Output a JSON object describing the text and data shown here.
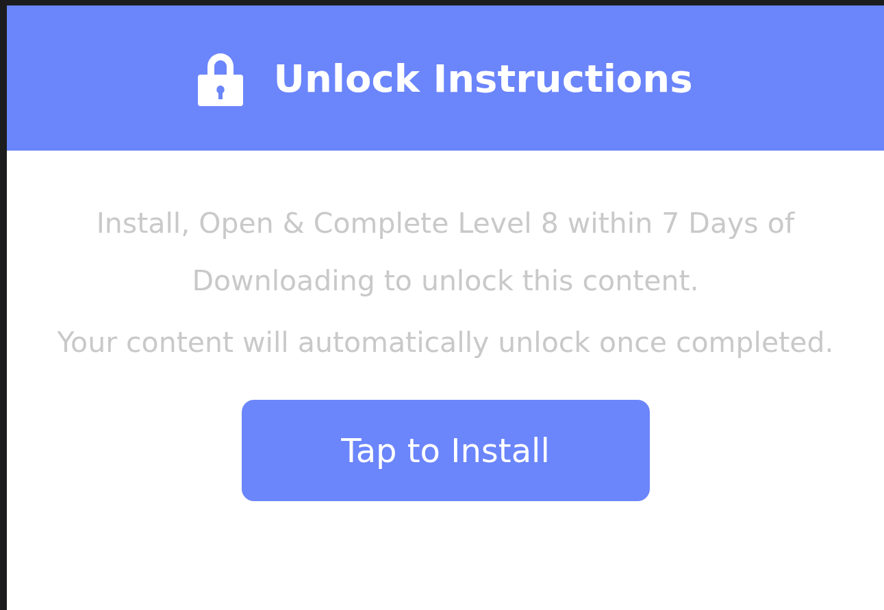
{
  "header": {
    "title": "Unlock Instructions"
  },
  "instructions": [
    "Install, Open & Complete Level 8 within 7 Days of Downloading to unlock this content.",
    "Your content will automatically unlock once completed."
  ],
  "button": {
    "label": "Tap to Install"
  }
}
